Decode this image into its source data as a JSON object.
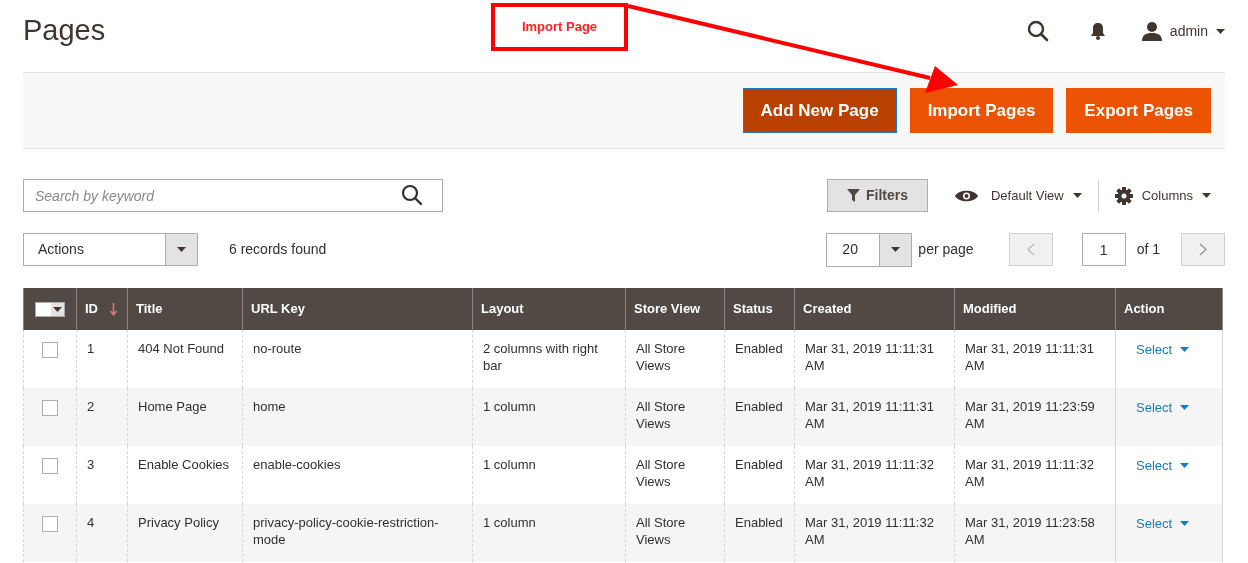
{
  "page_title": "Pages",
  "annotation": {
    "label": "Import Page"
  },
  "header": {
    "user": "admin"
  },
  "actions": [
    {
      "label": "Add New Page",
      "kind": "primary"
    },
    {
      "label": "Import Pages",
      "kind": "secondary"
    },
    {
      "label": "Export Pages",
      "kind": "secondary"
    }
  ],
  "search": {
    "placeholder": "Search by keyword"
  },
  "toolbar": {
    "filters": "Filters",
    "view": "Default View",
    "columns": "Columns"
  },
  "mass_actions": {
    "value": "Actions"
  },
  "records_found": "6 records found",
  "pager": {
    "per_page_value": "20",
    "per_page_label": "per page",
    "page": "1",
    "of": "of 1"
  },
  "table": {
    "columns": [
      {
        "label": "ID",
        "sorted": true
      },
      {
        "label": "Title",
        "sorted": false
      },
      {
        "label": "URL Key",
        "sorted": false
      },
      {
        "label": "Layout",
        "sorted": false
      },
      {
        "label": "Store View",
        "sorted": false
      },
      {
        "label": "Status",
        "sorted": false
      },
      {
        "label": "Created",
        "sorted": false
      },
      {
        "label": "Modified",
        "sorted": false
      },
      {
        "label": "Action",
        "sorted": false
      }
    ],
    "rows": [
      {
        "checked": false,
        "cells": [
          "1",
          "404 Not Found",
          "no-route",
          "2 columns with right bar",
          "All Store Views",
          "Enabled",
          "Mar 31, 2019 11:11:31 AM",
          "Mar 31, 2019 11:11:31 AM"
        ],
        "action": "Select"
      },
      {
        "checked": false,
        "cells": [
          "2",
          "Home Page",
          "home",
          "1 column",
          "All Store Views",
          "Enabled",
          "Mar 31, 2019 11:11:31 AM",
          "Mar 31, 2019 11:23:59 AM"
        ],
        "action": "Select"
      },
      {
        "checked": false,
        "cells": [
          "3",
          "Enable Cookies",
          "enable-cookies",
          "1 column",
          "All Store Views",
          "Enabled",
          "Mar 31, 2019 11:11:32 AM",
          "Mar 31, 2019 11:11:32 AM"
        ],
        "action": "Select"
      },
      {
        "checked": false,
        "cells": [
          "4",
          "Privacy Policy",
          "privacy-policy-cookie-restriction-mode",
          "1 column",
          "All Store Views",
          "Enabled",
          "Mar 31, 2019 11:11:32 AM",
          "Mar 31, 2019 11:23:58 AM"
        ],
        "action": "Select"
      }
    ]
  }
}
